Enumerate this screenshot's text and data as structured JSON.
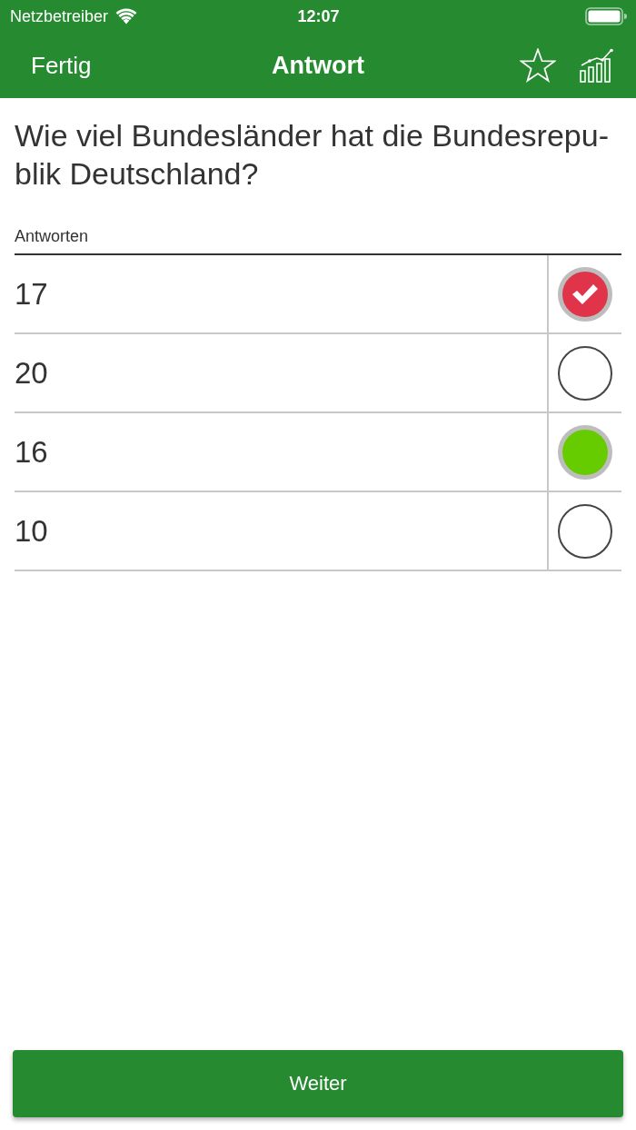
{
  "status_bar": {
    "carrier": "Netzbetreiber",
    "time": "12:07"
  },
  "nav_bar": {
    "left_button": "Fertig",
    "title": "Antwort"
  },
  "question": "Wie viel Bundesländer hat die Bundesrepu-blik Deutschland?",
  "answers_header": "Antworten",
  "answers": [
    {
      "text": "17",
      "selected": true,
      "correct": false
    },
    {
      "text": "20",
      "selected": false,
      "correct": false
    },
    {
      "text": "16",
      "selected": false,
      "correct": true
    },
    {
      "text": "10",
      "selected": false,
      "correct": false
    }
  ],
  "button": "Weiter"
}
